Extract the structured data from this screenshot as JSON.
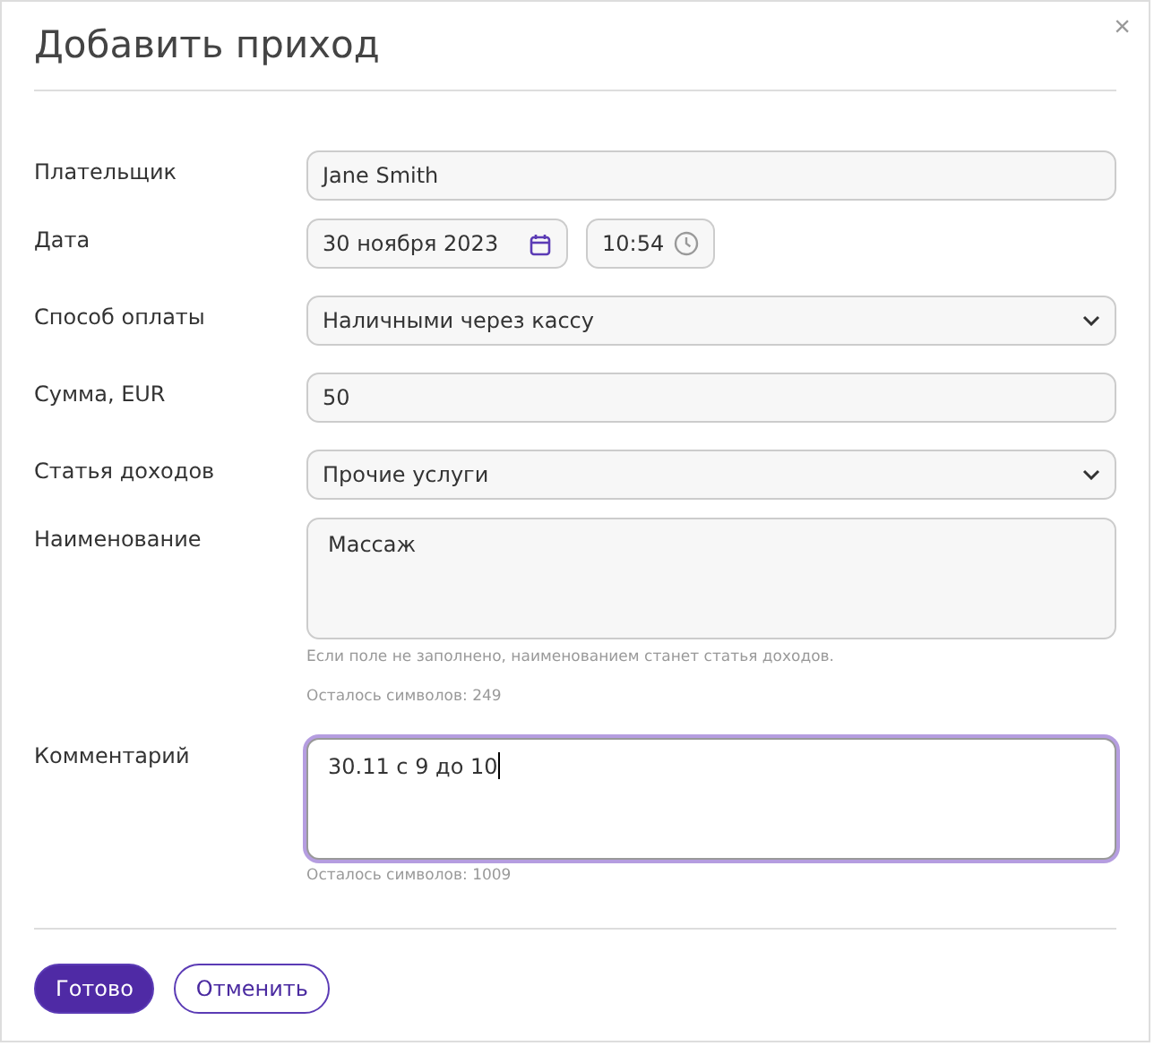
{
  "dialog": {
    "title": "Добавить приход",
    "close": "×"
  },
  "rows": [
    {
      "kind": "text",
      "label": "Плательщик",
      "value": "Jane Smith"
    },
    {
      "kind": "datetime",
      "label": "Дата",
      "value": "30 ноября 2023",
      "time": "10:54"
    },
    {
      "kind": "select",
      "label": "Способ оплаты",
      "value": "Наличными через кассу"
    },
    {
      "kind": "text",
      "label": "Сумма, EUR",
      "value": "50"
    },
    {
      "kind": "select",
      "label": "Статья доходов",
      "value": "Прочие услуги"
    },
    {
      "kind": "textarea",
      "label": "Наименование",
      "value": "Массаж",
      "focused": false,
      "hint": "Если поле не заполнено, наименованием станет статья доходов.",
      "counter": "Осталось символов: 249"
    },
    {
      "kind": "textarea",
      "label": "Комментарий",
      "value": "30.11 с 9 до 10",
      "focused": true,
      "counter": "Осталось символов: 1009"
    }
  ],
  "buttons": [
    {
      "label": "Готово",
      "primary": true
    },
    {
      "label": "Отменить",
      "primary": false
    }
  ]
}
